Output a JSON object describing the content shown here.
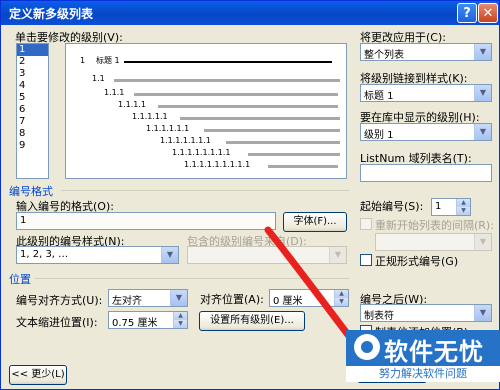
{
  "window": {
    "title": "定义新多级列表",
    "help_glyph": "?",
    "close_glyph": "✕"
  },
  "level_list": {
    "label": "单击要修改的级别(V):",
    "items": [
      "1",
      "2",
      "3",
      "4",
      "5",
      "6",
      "7",
      "8",
      "9"
    ],
    "selected": "1"
  },
  "preview": {
    "rows": [
      {
        "num": "1",
        "text": "标题 1"
      },
      {
        "num": "1.1",
        "text": ""
      },
      {
        "num": "1.1.1",
        "text": ""
      },
      {
        "num": "1.1.1.1",
        "text": ""
      },
      {
        "num": "1.1.1.1.1",
        "text": ""
      },
      {
        "num": "1.1.1.1.1.1",
        "text": ""
      },
      {
        "num": "1.1.1.1.1.1.1",
        "text": ""
      },
      {
        "num": "1.1.1.1.1.1.1.1",
        "text": ""
      },
      {
        "num": "1.1.1.1.1.1.1.1.1",
        "text": ""
      }
    ]
  },
  "right_panel": {
    "apply_label": "将更改应用于(C):",
    "apply_value": "整个列表",
    "link_label": "将级别链接到样式(K):",
    "link_value": "标题 1",
    "gallery_label": "要在库中显示的级别(H):",
    "gallery_value": "级别 1",
    "listnum_label": "ListNum 域列表名(T):",
    "listnum_value": ""
  },
  "number_format": {
    "group_label": "编号格式",
    "format_label": "输入编号的格式(O):",
    "format_value": "1",
    "font_button": "字体(F)...",
    "style_label": "此级别的编号样式(N):",
    "style_value": "1, 2, 3, …",
    "include_label": "包含的级别编号来自(D):",
    "include_value": "",
    "start_label": "起始编号(S):",
    "start_value": "1",
    "restart_label": "重新开始列表的间隔(R):",
    "restart_value": "",
    "legal_label": "正规形式编号(G)"
  },
  "position": {
    "group_label": "位置",
    "align_label": "编号对齐方式(U):",
    "align_value": "左对齐",
    "aligned_at_label": "对齐位置(A):",
    "aligned_at_value": "0 厘米",
    "indent_label": "文本缩进位置(I):",
    "indent_value": "0.75 厘米",
    "set_all_button": "设置所有级别(E)...",
    "follow_label": "编号之后(W):",
    "follow_value": "制表符",
    "tab_label": "制表位添加位置(B):"
  },
  "footer": {
    "less_button": "<< 更少(L)"
  },
  "watermark": {
    "brand": "软件无忧",
    "slogan": "努力解决软件问题"
  },
  "colors": {
    "titlebar": "#0747c6",
    "dialog_bg": "#ece9d8",
    "selection": "#316ac5",
    "group_label": "#0046d5",
    "annotation_arrow": "#e8231f",
    "watermark": "#2672c7"
  }
}
